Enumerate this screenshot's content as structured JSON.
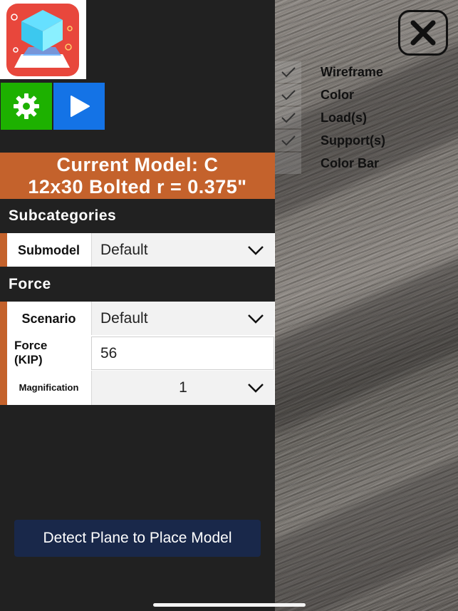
{
  "toolbar": {
    "settings_icon": "gear-icon",
    "play_icon": "play-icon",
    "settings_color": "#1db100",
    "play_color": "#1473e6"
  },
  "model": {
    "line1": "Current Model: C",
    "line2": "12x30 Bolted r = 0.375\"",
    "banner_color": "#c4622c"
  },
  "subcategories": {
    "header": "Subcategories",
    "submodel_label": "Submodel",
    "submodel_value": "Default"
  },
  "force": {
    "header": "Force",
    "scenario_label": "Scenario",
    "scenario_value": "Default",
    "force_label": "Force\n(KIP)",
    "force_value": "56",
    "magnification_label": "Magnification",
    "magnification_value": "1"
  },
  "detect_button": "Detect Plane to Place Model",
  "layers": [
    {
      "label": "Wireframe",
      "checked": true
    },
    {
      "label": "Color",
      "checked": true
    },
    {
      "label": "Load(s)",
      "checked": true
    },
    {
      "label": "Support(s)",
      "checked": true
    },
    {
      "label": "Color Bar",
      "checked": false
    }
  ]
}
